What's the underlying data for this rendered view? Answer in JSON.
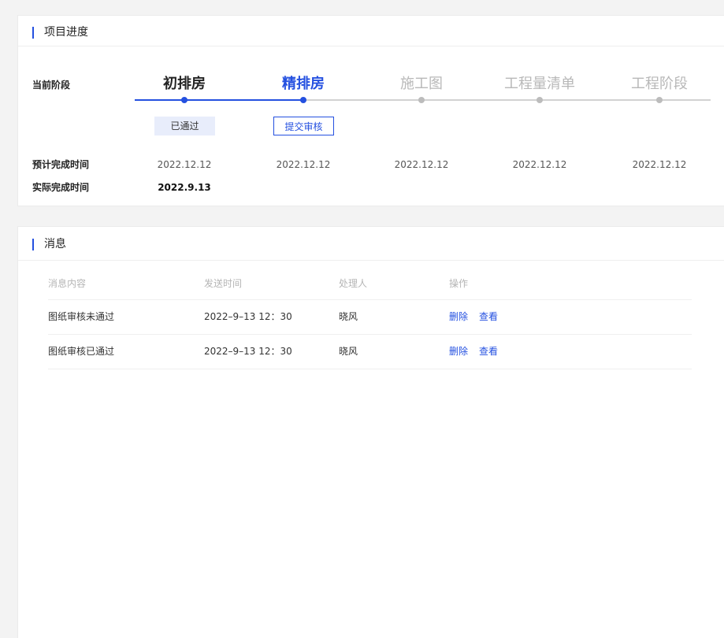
{
  "progress": {
    "title": "项目进度",
    "current_stage_label": "当前阶段",
    "planned_label": "预计完成时间",
    "actual_label": "实际完成时间",
    "stages": [
      {
        "name": "初排房",
        "status": "done",
        "status_text": "已通过",
        "planned": "2022.12.12",
        "actual": "2022.9.13"
      },
      {
        "name": "精排房",
        "status": "current",
        "action_text": "提交审核",
        "planned": "2022.12.12",
        "actual": ""
      },
      {
        "name": "施工图",
        "status": "pending",
        "planned": "2022.12.12",
        "actual": ""
      },
      {
        "name": "工程量清单",
        "status": "pending",
        "planned": "2022.12.12",
        "actual": ""
      },
      {
        "name": "工程阶段",
        "status": "pending",
        "planned": "2022.12.12",
        "actual": ""
      }
    ]
  },
  "messages": {
    "title": "消息",
    "columns": [
      "消息内容",
      "发送时间",
      "处理人",
      "操作"
    ],
    "rows": [
      {
        "content": "图纸审核未通过",
        "time": "2022–9–13 12：30",
        "handler": "晓风",
        "actions": [
          "删除",
          "查看"
        ]
      },
      {
        "content": "图纸审核已通过",
        "time": "2022–9–13 12：30",
        "handler": "晓风",
        "actions": [
          "删除",
          "查看"
        ]
      }
    ]
  },
  "colors": {
    "accent": "#2450e0",
    "pending": "#b8b8b8",
    "tag_bg": "#e8edfb"
  }
}
